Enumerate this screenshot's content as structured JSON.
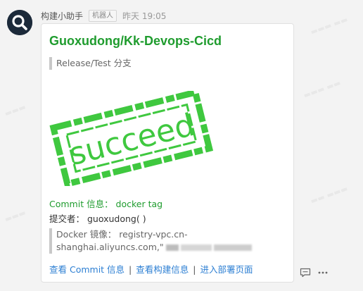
{
  "message": {
    "sender": "构建小助手",
    "badge": "机器人",
    "time": "昨天 19:05"
  },
  "card": {
    "title": "Guoxudong/Kk-Devops-Cicd",
    "branch": "Release/Test 分支",
    "stamp_text": "succeed",
    "commit_line": "Commit 信息： docker tag",
    "submitter_line": "提交者：  guoxudong( )",
    "image_line1": "Docker 镜像：  registry-vpc.cn-",
    "image_line2": "shanghai.aliyuncs.com,\""
  },
  "links": {
    "view_commit": "查看 Commit 信息",
    "view_build": "查看构建信息",
    "deploy_page": "进入部署页面",
    "separator": "|"
  },
  "actions": [
    {
      "icon": "comment-icon"
    },
    {
      "icon": "more-icon"
    }
  ],
  "colors": {
    "accent_green": "#1f9c2e",
    "stamp_green": "#3fc83f",
    "link_blue": "#2d7fd3"
  }
}
